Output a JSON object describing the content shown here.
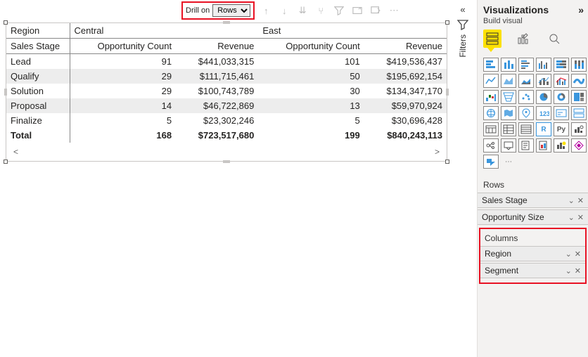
{
  "toolbar": {
    "drill_label": "Drill on",
    "drill_select": "Rows"
  },
  "matrix": {
    "row_header": "Region",
    "row_subheader": "Sales Stage",
    "regions": [
      "Central",
      "East"
    ],
    "measures": [
      "Opportunity Count",
      "Revenue"
    ],
    "rows": [
      {
        "stage": "Lead",
        "c_cnt": "91",
        "c_rev": "$441,033,315",
        "e_cnt": "101",
        "e_rev": "$419,536,437"
      },
      {
        "stage": "Qualify",
        "c_cnt": "29",
        "c_rev": "$111,715,461",
        "e_cnt": "50",
        "e_rev": "$195,692,154"
      },
      {
        "stage": "Solution",
        "c_cnt": "29",
        "c_rev": "$100,743,789",
        "e_cnt": "30",
        "e_rev": "$134,347,170"
      },
      {
        "stage": "Proposal",
        "c_cnt": "14",
        "c_rev": "$46,722,869",
        "e_cnt": "13",
        "e_rev": "$59,970,924"
      },
      {
        "stage": "Finalize",
        "c_cnt": "5",
        "c_rev": "$23,302,246",
        "e_cnt": "5",
        "e_rev": "$30,696,428"
      }
    ],
    "total": {
      "label": "Total",
      "c_cnt": "168",
      "c_rev": "$723,517,680",
      "e_cnt": "199",
      "e_rev": "$840,243,113"
    }
  },
  "filters": {
    "label": "Filters"
  },
  "viz": {
    "title": "Visualizations",
    "subtitle": "Build visual",
    "rows_label": "Rows",
    "rows_fields": [
      "Sales Stage",
      "Opportunity Size"
    ],
    "cols_label": "Columns",
    "cols_fields": [
      "Region",
      "Segment"
    ]
  },
  "chart_data": {
    "type": "table",
    "title": "Opportunity Count and Revenue by Region and Sales Stage",
    "row_dimension": "Sales Stage",
    "column_dimension": "Region",
    "categories": [
      "Lead",
      "Qualify",
      "Solution",
      "Proposal",
      "Finalize"
    ],
    "series": [
      {
        "name": "Central – Opportunity Count",
        "values": [
          91,
          29,
          29,
          14,
          5
        ]
      },
      {
        "name": "Central – Revenue",
        "values": [
          441033315,
          111715461,
          100743789,
          46722869,
          23302246
        ]
      },
      {
        "name": "East – Opportunity Count",
        "values": [
          101,
          50,
          30,
          13,
          5
        ]
      },
      {
        "name": "East – Revenue",
        "values": [
          419536437,
          195692154,
          134347170,
          59970924,
          30696428
        ]
      }
    ],
    "totals": {
      "Central – Opportunity Count": 168,
      "Central – Revenue": 723517680,
      "East – Opportunity Count": 199,
      "East – Revenue": 840243113
    }
  }
}
